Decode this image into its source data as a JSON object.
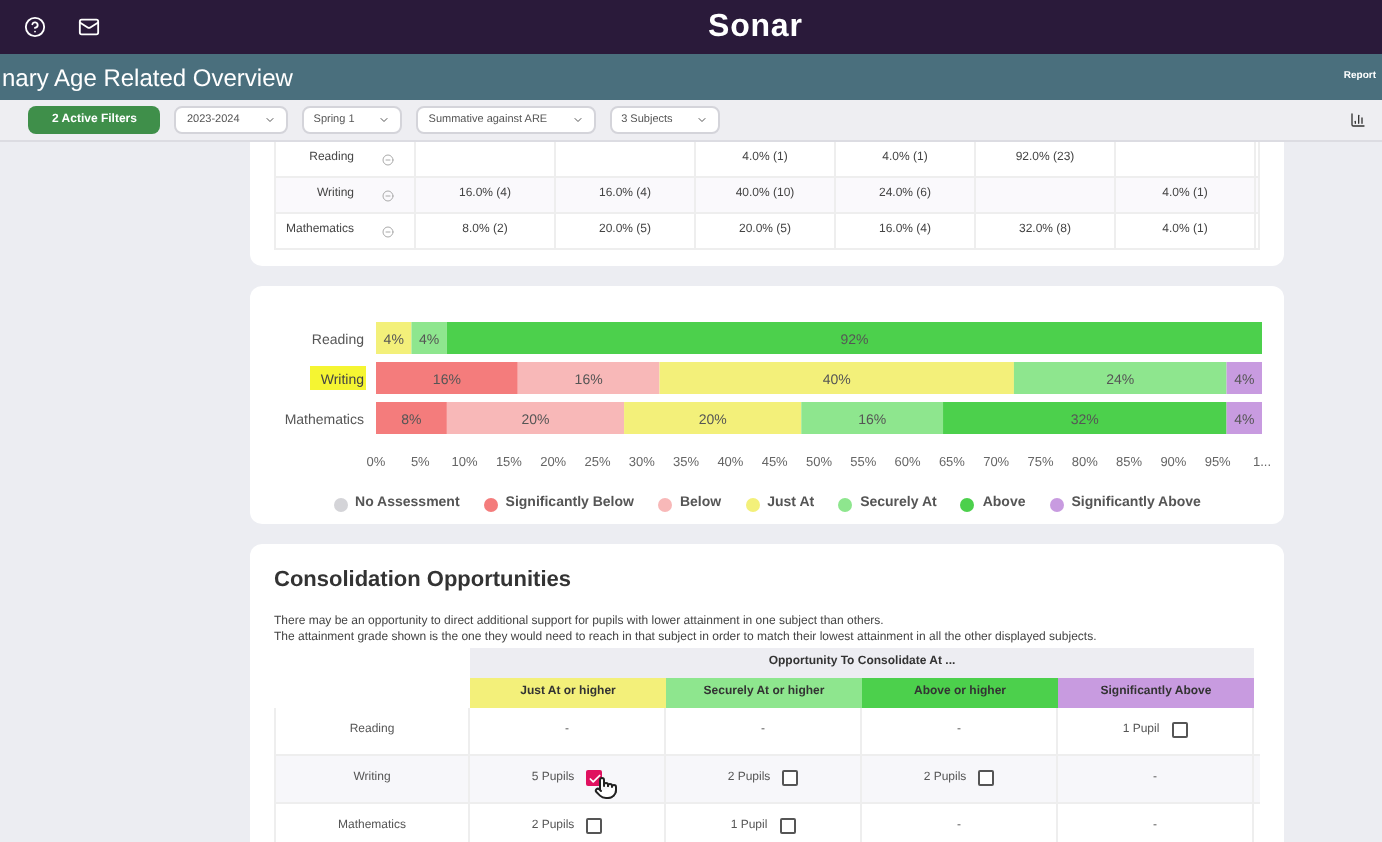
{
  "top_bar": {
    "logo": "Sonar"
  },
  "title_bar": {
    "title": "nary Age Related Overview",
    "right_link": "Report"
  },
  "filters": {
    "active_button": "2 Active Filters",
    "dropdowns": [
      "2023-2024",
      "Spring 1",
      "Summative against ARE",
      "3 Subjects"
    ]
  },
  "attainment_table": {
    "rows": [
      {
        "subject": "Reading",
        "cells": [
          null,
          null,
          "4.0% (1)",
          "4.0% (1)",
          "92.0% (23)",
          null
        ]
      },
      {
        "subject": "Writing",
        "cells": [
          "16.0% (4)",
          "16.0% (4)",
          "40.0% (10)",
          "24.0% (6)",
          null,
          "4.0% (1)"
        ]
      },
      {
        "subject": "Mathematics",
        "cells": [
          "8.0% (2)",
          "20.0% (5)",
          "20.0% (5)",
          "16.0% (4)",
          "32.0% (8)",
          "4.0% (1)"
        ]
      }
    ]
  },
  "attainment_chart": {
    "row_highlight": [
      false,
      true,
      false
    ],
    "chart_data": {
      "type": "bar",
      "orientation": "horizontal",
      "stacked": true,
      "legend": "bottom",
      "categories": [
        "Reading",
        "Writing",
        "Mathematics"
      ],
      "xlim": [
        0,
        100
      ],
      "xticks": [
        {
          "value": 0,
          "label": "0%"
        },
        {
          "value": 5,
          "label": "5%"
        },
        {
          "value": 10,
          "label": "10%"
        },
        {
          "value": 15,
          "label": "15%"
        },
        {
          "value": 20,
          "label": "20%"
        },
        {
          "value": 25,
          "label": "25%"
        },
        {
          "value": 30,
          "label": "30%"
        },
        {
          "value": 35,
          "label": "35%"
        },
        {
          "value": 40,
          "label": "40%"
        },
        {
          "value": 45,
          "label": "45%"
        },
        {
          "value": 50,
          "label": "50%"
        },
        {
          "value": 55,
          "label": "55%"
        },
        {
          "value": 60,
          "label": "60%"
        },
        {
          "value": 65,
          "label": "65%"
        },
        {
          "value": 70,
          "label": "70%"
        },
        {
          "value": 75,
          "label": "75%"
        },
        {
          "value": 80,
          "label": "80%"
        },
        {
          "value": 85,
          "label": "85%"
        },
        {
          "value": 90,
          "label": "90%"
        },
        {
          "value": 95,
          "label": "95%"
        },
        {
          "value": 100,
          "label": "1..."
        }
      ],
      "series": [
        {
          "name": "No Assessment",
          "color": "#d4d4d8",
          "values": [
            0,
            0,
            0
          ],
          "value_labels": [
            null,
            null,
            null
          ]
        },
        {
          "name": "Significantly Below",
          "color": "#f47c7c",
          "values": [
            0,
            16,
            8
          ],
          "value_labels": [
            null,
            "16%",
            "8%"
          ]
        },
        {
          "name": "Below",
          "color": "#f8b8b8",
          "values": [
            0,
            16,
            20
          ],
          "value_labels": [
            null,
            "16%",
            "20%"
          ]
        },
        {
          "name": "Just At",
          "color": "#f3f07a",
          "values": [
            4,
            40,
            20
          ],
          "value_labels": [
            "4%",
            "40%",
            "20%"
          ]
        },
        {
          "name": "Securely At",
          "color": "#8ee68e",
          "values": [
            4,
            24,
            16
          ],
          "value_labels": [
            "4%",
            "24%",
            "16%"
          ]
        },
        {
          "name": "Above",
          "color": "#4cd04c",
          "values": [
            92,
            0,
            32
          ],
          "value_labels": [
            "92%",
            null,
            "32%"
          ]
        },
        {
          "name": "Significantly Above",
          "color": "#c89be0",
          "values": [
            0,
            4,
            4
          ],
          "value_labels": [
            null,
            "4%",
            "4%"
          ]
        }
      ]
    }
  },
  "consolidation": {
    "title": "Consolidation Opportunities",
    "description": [
      "There may be an opportunity to direct additional support for pupils with lower attainment in one subject than others.",
      "The attainment grade shown is the one they would need to reach in that subject in order to match their lowest attainment in all the other displayed subjects."
    ],
    "group_header": "Opportunity To Consolidate At ...",
    "columns": [
      {
        "label": "Just At or higher",
        "color": "#f3f07a"
      },
      {
        "label": "Securely At or higher",
        "color": "#8ee68e"
      },
      {
        "label": "Above or higher",
        "color": "#4cd04c"
      },
      {
        "label": "Significantly Above",
        "color": "#c89be0"
      }
    ],
    "rows": [
      {
        "subject": "Reading",
        "cells": [
          {
            "kind": "none",
            "text": "-"
          },
          {
            "kind": "none",
            "text": "-"
          },
          {
            "kind": "none",
            "text": "-"
          },
          {
            "kind": "count",
            "text": "1 Pupil",
            "checked": false
          }
        ]
      },
      {
        "subject": "Writing",
        "cells": [
          {
            "kind": "count",
            "text": "5 Pupils",
            "checked": true
          },
          {
            "kind": "count",
            "text": "2 Pupils",
            "checked": false
          },
          {
            "kind": "count",
            "text": "2 Pupils",
            "checked": false
          },
          {
            "kind": "none",
            "text": "-"
          }
        ]
      },
      {
        "subject": "Mathematics",
        "cells": [
          {
            "kind": "count",
            "text": "2 Pupils",
            "checked": false
          },
          {
            "kind": "count",
            "text": "1 Pupil",
            "checked": false
          },
          {
            "kind": "none",
            "text": "-"
          },
          {
            "kind": "none",
            "text": "-"
          }
        ]
      }
    ]
  }
}
